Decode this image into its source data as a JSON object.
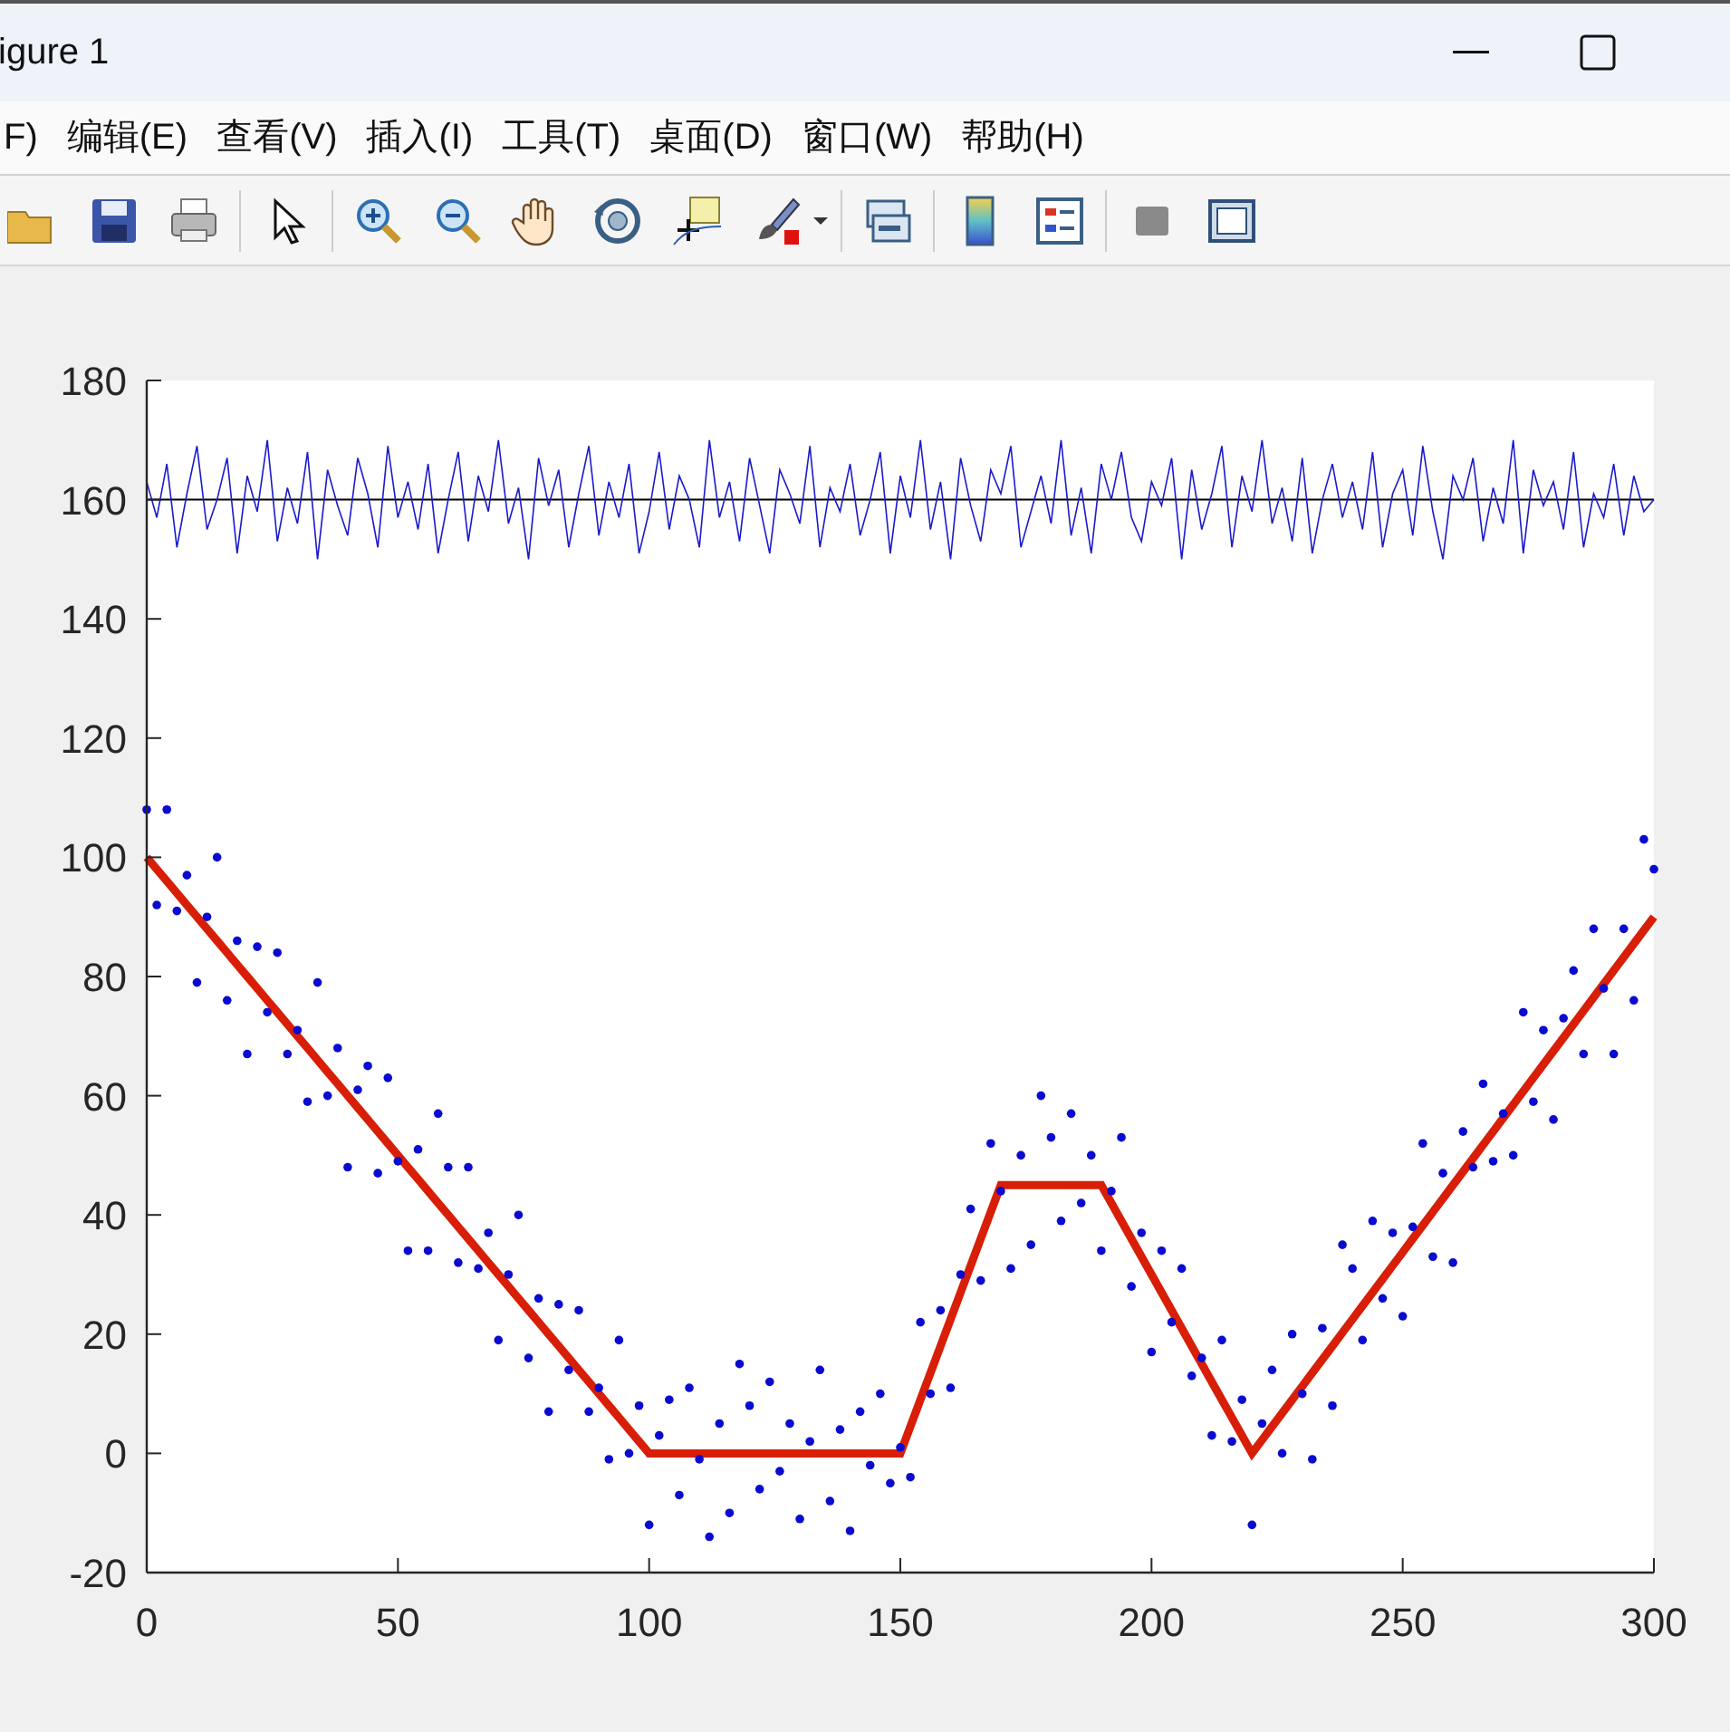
{
  "window": {
    "title": "igure 1"
  },
  "menu": [
    {
      "label": "F)"
    },
    {
      "label": "编辑(E)"
    },
    {
      "label": "查看(V)"
    },
    {
      "label": "插入(I)"
    },
    {
      "label": "工具(T)"
    },
    {
      "label": "桌面(D)"
    },
    {
      "label": "窗口(W)"
    },
    {
      "label": "帮助(H)"
    }
  ],
  "figure": {
    "chart_data": {
      "type": "line",
      "x": [
        0,
        2,
        4,
        6,
        8,
        10,
        12,
        14,
        16,
        18,
        20,
        22,
        24,
        26,
        28,
        30,
        32,
        34,
        36,
        38,
        40,
        42,
        44,
        46,
        48,
        50,
        52,
        54,
        56,
        58,
        60,
        62,
        64,
        66,
        68,
        70,
        72,
        74,
        76,
        78,
        80,
        82,
        84,
        86,
        88,
        90,
        92,
        94,
        96,
        98,
        100,
        102,
        104,
        106,
        108,
        110,
        112,
        114,
        116,
        118,
        120,
        122,
        124,
        126,
        128,
        130,
        132,
        134,
        136,
        138,
        140,
        142,
        144,
        146,
        148,
        150,
        152,
        154,
        156,
        158,
        160,
        162,
        164,
        166,
        168,
        170,
        172,
        174,
        176,
        178,
        180,
        182,
        184,
        186,
        188,
        190,
        192,
        194,
        196,
        198,
        200,
        202,
        204,
        206,
        208,
        210,
        212,
        214,
        216,
        218,
        220,
        222,
        224,
        226,
        228,
        230,
        232,
        234,
        236,
        238,
        240,
        242,
        244,
        246,
        248,
        250,
        252,
        254,
        256,
        258,
        260,
        262,
        264,
        266,
        268,
        270,
        272,
        274,
        276,
        278,
        280,
        282,
        284,
        286,
        288,
        290,
        292,
        294,
        296,
        298,
        300
      ],
      "series": [
        {
          "color": "#d81e06",
          "values": [
            100,
            98,
            96,
            94,
            92,
            90,
            88,
            86,
            84,
            82,
            80,
            78,
            76,
            74,
            72,
            70,
            68,
            66,
            64,
            62,
            60,
            58,
            56,
            54,
            52,
            50,
            48,
            46,
            44,
            42,
            40,
            38,
            36,
            34,
            32,
            30,
            28,
            26,
            24,
            22,
            20,
            18,
            16,
            14,
            12,
            10,
            8,
            6,
            4,
            2,
            0,
            0,
            0,
            0,
            0,
            0,
            0,
            0,
            0,
            0,
            0,
            0,
            0,
            0,
            0,
            0,
            0,
            0,
            0,
            0,
            0,
            0,
            0,
            0,
            0,
            0,
            4.5,
            9,
            13.5,
            18,
            22.5,
            27,
            31.5,
            36,
            40.5,
            45,
            45,
            45,
            45,
            45,
            45,
            45,
            45,
            45,
            45,
            45,
            42,
            39,
            36,
            33,
            30,
            27,
            24,
            21,
            18,
            15,
            12,
            9,
            6,
            3,
            0,
            2.25,
            4.5,
            6.75,
            9,
            11.25,
            13.5,
            15.75,
            18,
            20.25,
            22.5,
            24.75,
            27,
            29.25,
            31.5,
            33.75,
            36,
            38.25,
            40.5,
            42.75,
            45,
            47.25,
            49.5,
            51.75,
            54,
            56.25,
            58.5,
            60.75,
            63,
            65.25,
            67.5,
            69.75,
            72,
            74.25,
            76.5,
            78.75,
            81,
            83.25,
            85.5,
            87.75,
            90
          ]
        },
        {
          "color": "#000000",
          "values": [
            160,
            160,
            160,
            160,
            160,
            160,
            160,
            160,
            160,
            160,
            160,
            160,
            160,
            160,
            160,
            160,
            160,
            160,
            160,
            160,
            160,
            160,
            160,
            160,
            160,
            160,
            160,
            160,
            160,
            160,
            160,
            160,
            160,
            160,
            160,
            160,
            160,
            160,
            160,
            160,
            160,
            160,
            160,
            160,
            160,
            160,
            160,
            160,
            160,
            160,
            160,
            160,
            160,
            160,
            160,
            160,
            160,
            160,
            160,
            160,
            160,
            160,
            160,
            160,
            160,
            160,
            160,
            160,
            160,
            160,
            160,
            160,
            160,
            160,
            160,
            160,
            160,
            160,
            160,
            160,
            160,
            160,
            160,
            160,
            160,
            160,
            160,
            160,
            160,
            160,
            160,
            160,
            160,
            160,
            160,
            160,
            160,
            160,
            160,
            160,
            160,
            160,
            160,
            160,
            160,
            160,
            160,
            160,
            160,
            160,
            160,
            160,
            160,
            160,
            160,
            160,
            160,
            160,
            160,
            160,
            160,
            160,
            160,
            160,
            160,
            160,
            160,
            160,
            160,
            160,
            160,
            160,
            160,
            160,
            160,
            160,
            160,
            160,
            160,
            160,
            160,
            160,
            160,
            160,
            160,
            160,
            160,
            160,
            160,
            160,
            160
          ]
        },
        {
          "color": "#1a1acc",
          "values": [
            163,
            157,
            166,
            152,
            161,
            169,
            155,
            160,
            167,
            151,
            164,
            158,
            170,
            153,
            162,
            156,
            168,
            150,
            165,
            159,
            154,
            167,
            161,
            152,
            169,
            157,
            163,
            155,
            166,
            151,
            160,
            168,
            153,
            164,
            158,
            170,
            156,
            162,
            150,
            167,
            159,
            165,
            152,
            161,
            169,
            154,
            163,
            157,
            166,
            151,
            158,
            168,
            155,
            164,
            160,
            152,
            170,
            157,
            163,
            153,
            167,
            159,
            151,
            165,
            161,
            156,
            169,
            152,
            162,
            158,
            166,
            154,
            160,
            168,
            151,
            164,
            157,
            170,
            155,
            163,
            150,
            167,
            159,
            153,
            165,
            161,
            169,
            152,
            158,
            164,
            156,
            170,
            154,
            162,
            151,
            166,
            160,
            168,
            157,
            153,
            163,
            159,
            167,
            150,
            165,
            155,
            161,
            169,
            152,
            164,
            158,
            170,
            156,
            162,
            153,
            167,
            151,
            160,
            166,
            157,
            163,
            155,
            168,
            152,
            161,
            165,
            154,
            169,
            158,
            150,
            164,
            160,
            167,
            153,
            162,
            156,
            170,
            151,
            165,
            159,
            163,
            155,
            168,
            152,
            161,
            157,
            166,
            154,
            164,
            158,
            160
          ]
        },
        {
          "color": "#0a0ad0",
          "type": "scatter",
          "values": [
            108,
            92,
            108,
            91,
            97,
            79,
            90,
            100,
            76,
            86,
            67,
            85,
            74,
            84,
            67,
            71,
            59,
            79,
            60,
            68,
            48,
            61,
            65,
            47,
            63,
            49,
            34,
            51,
            34,
            57,
            48,
            32,
            48,
            31,
            37,
            19,
            30,
            40,
            16,
            26,
            7,
            25,
            14,
            24,
            7,
            11,
            -1,
            19,
            0,
            8,
            -12,
            3,
            9,
            -7,
            11,
            -1,
            -14,
            5,
            -10,
            15,
            8,
            -6,
            12,
            -3,
            5,
            -11,
            2,
            14,
            -8,
            4,
            -13,
            7,
            -2,
            10,
            -5,
            1,
            -4,
            22,
            10,
            24,
            11,
            30,
            41,
            29,
            52,
            44,
            31,
            50,
            35,
            60,
            53,
            39,
            57,
            42,
            50,
            34,
            44,
            53,
            28,
            37,
            17,
            34,
            22,
            31,
            13,
            16,
            3,
            19,
            2,
            9,
            -12,
            5,
            14,
            0,
            20,
            10,
            -1,
            21,
            8,
            35,
            31,
            19,
            39,
            26,
            37,
            23,
            38,
            52,
            33,
            47,
            32,
            54,
            48,
            62,
            49,
            57,
            50,
            74,
            59,
            71,
            56,
            73,
            81,
            67,
            88,
            78,
            67,
            88,
            76,
            103,
            98
          ]
        }
      ],
      "xlim": [
        0,
        300
      ],
      "ylim": [
        -20,
        180
      ],
      "xticks": [
        0,
        50,
        100,
        150,
        200,
        250,
        300
      ],
      "yticks": [
        -20,
        0,
        20,
        40,
        60,
        80,
        100,
        120,
        140,
        160,
        180
      ]
    }
  }
}
